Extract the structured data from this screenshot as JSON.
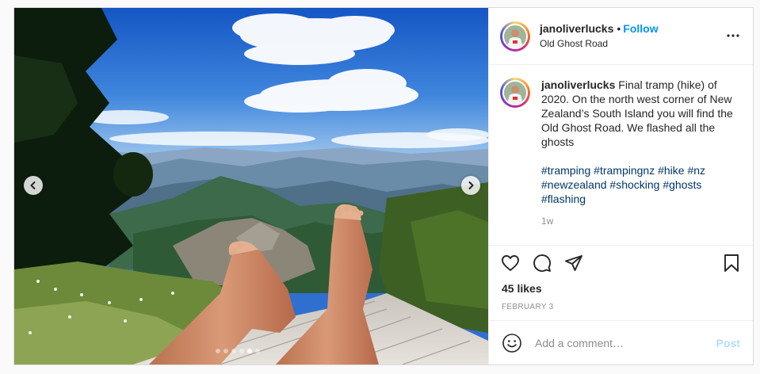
{
  "post": {
    "username": "janoliverlucks",
    "separator": "•",
    "follow_label": "Follow",
    "location": "Old Ghost Road",
    "more_icon": "more-horizontal-icon",
    "caption": {
      "username": "janoliverlucks",
      "text": "Final tramp (hike) of 2020. On the north west corner of New Zealand’s South Island you will find the Old Ghost Road. We flashed all the ghosts",
      "hashtags": [
        "#tramping",
        "#trampingnz",
        "#hike",
        "#nz",
        "#newzealand",
        "#shocking",
        "#ghosts",
        "#flashing"
      ]
    },
    "time_ago": "1w",
    "likes": "45 likes",
    "date": "FEBRUARY 3",
    "comment": {
      "placeholder": "Add a comment…",
      "post_label": "Post"
    },
    "carousel": {
      "slide_count": 6,
      "active_index": 4
    }
  },
  "colors": {
    "follow": "#0095f6",
    "hashtag": "#00376b",
    "muted": "#8e8e8e",
    "post_disabled": "#b2dffc"
  }
}
